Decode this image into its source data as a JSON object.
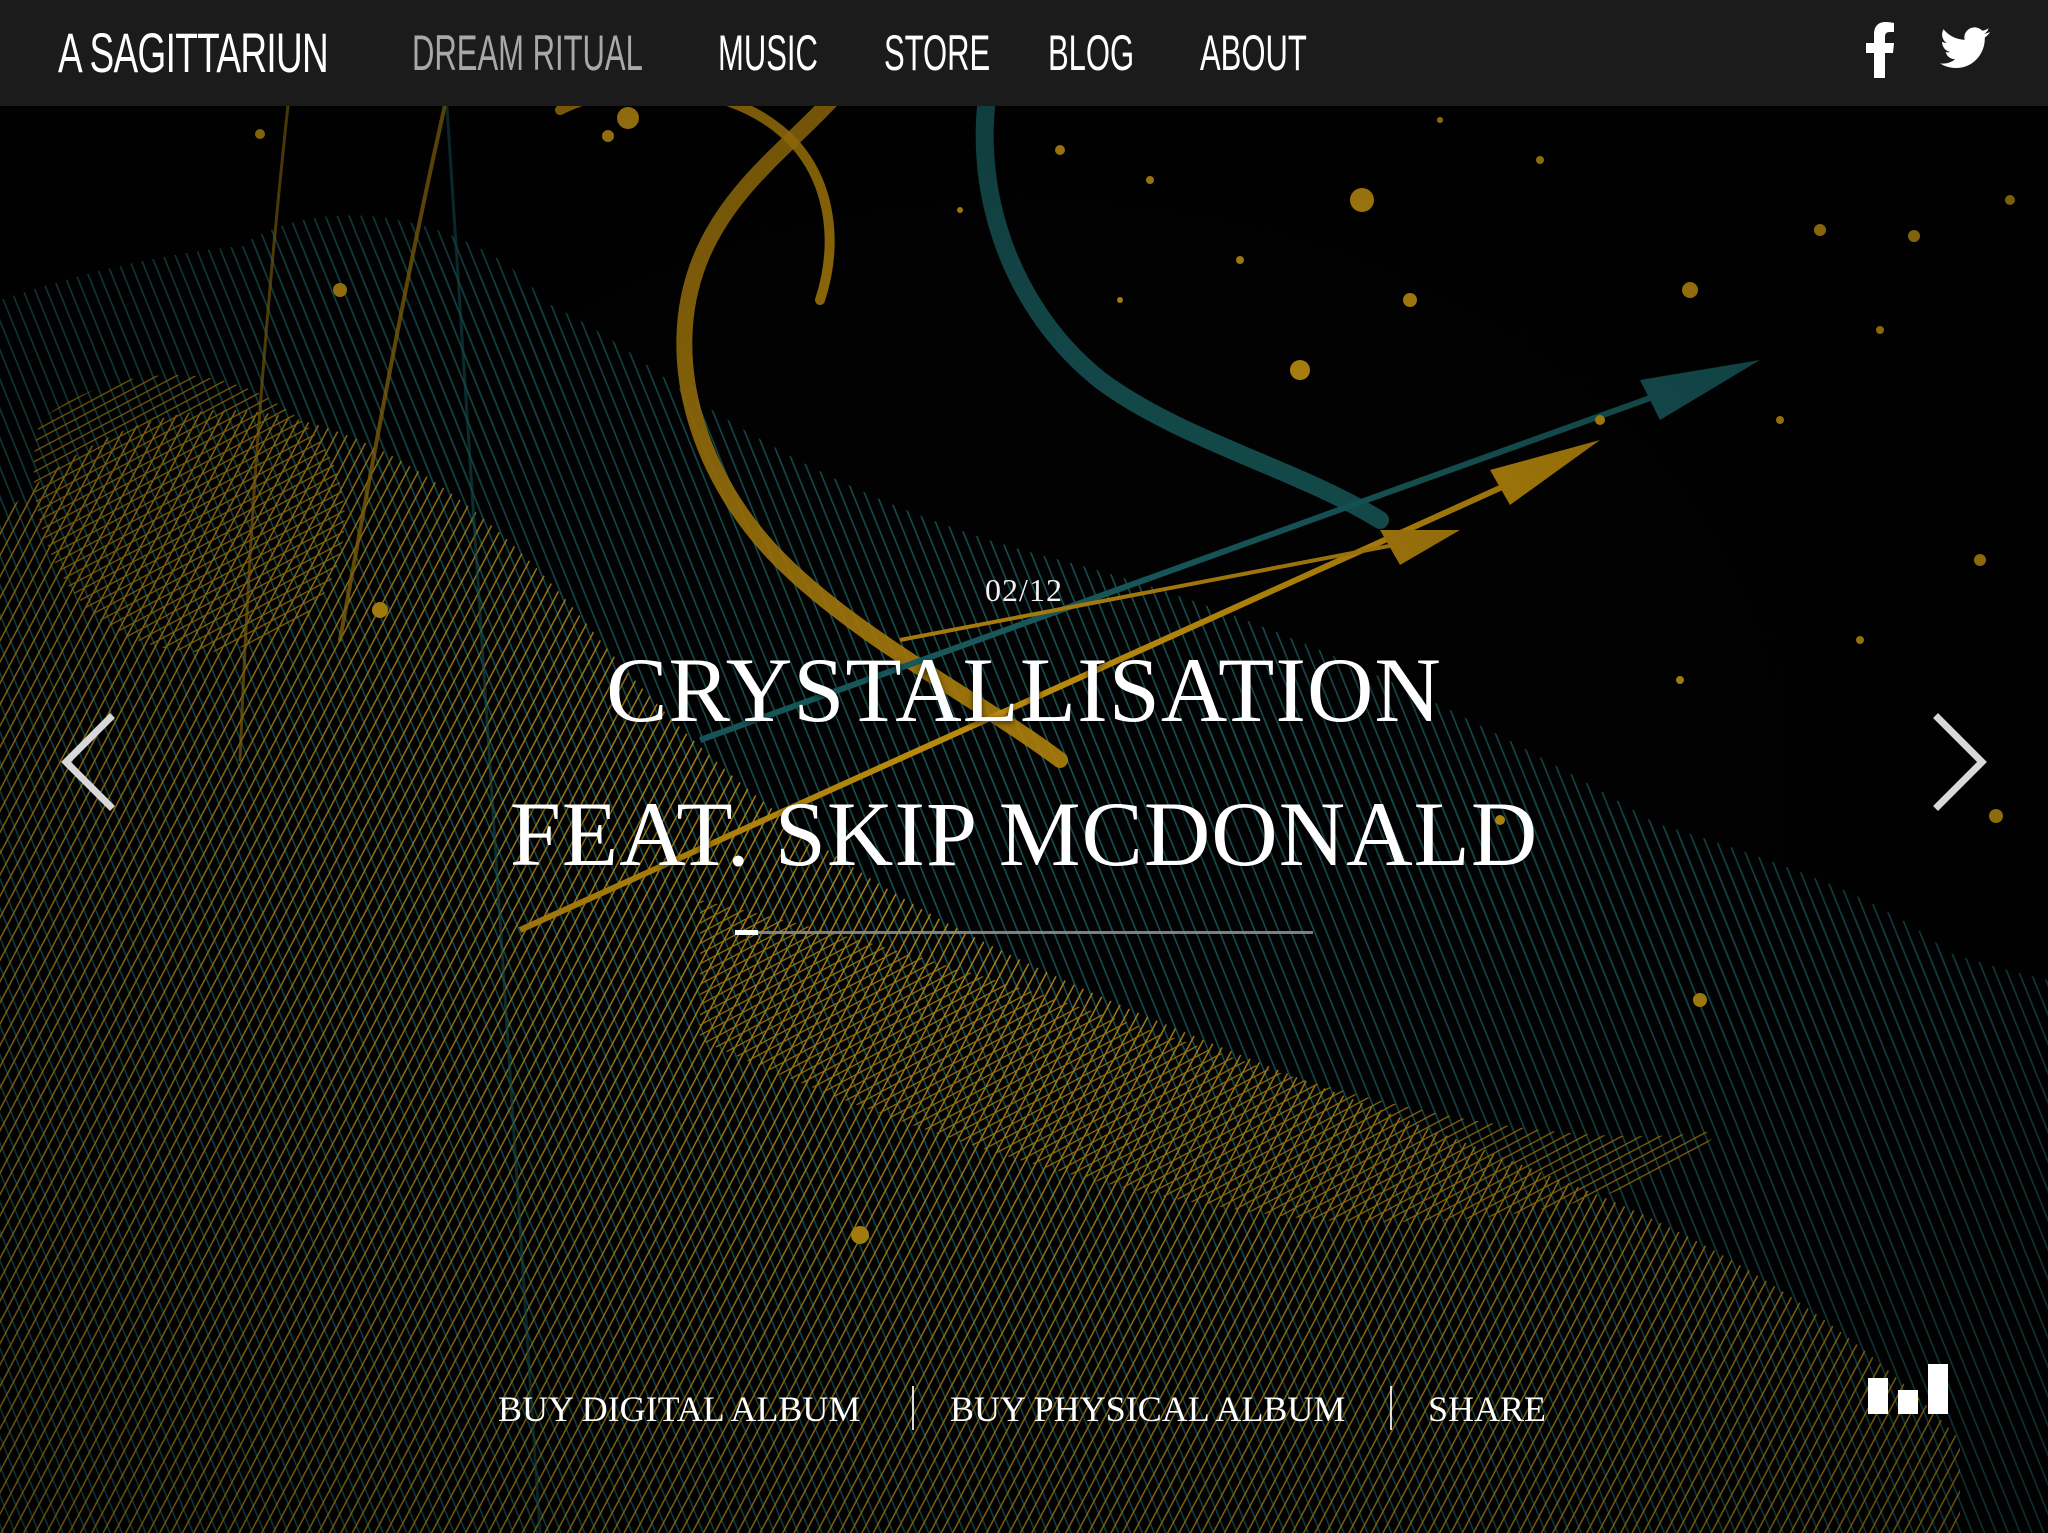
{
  "header": {
    "brand": "A Sagittariun",
    "nav": [
      {
        "label": "Dream Ritual",
        "active": true
      },
      {
        "label": "Music",
        "active": false
      },
      {
        "label": "Store",
        "active": false
      },
      {
        "label": "Blog",
        "active": false
      },
      {
        "label": "About",
        "active": false
      }
    ],
    "social": [
      {
        "icon": "facebook-icon"
      },
      {
        "icon": "twitter-icon"
      }
    ]
  },
  "slide": {
    "counter": "02/12",
    "title_line1": "CRYSTALLISATION",
    "title_line2": "FEAT. SKIP MCDONALD",
    "progress": 0.04
  },
  "navigation": {
    "prev_icon": "chevron-left-icon",
    "next_icon": "chevron-right-icon"
  },
  "actions": [
    {
      "label": "BUY DIGITAL ALBUM"
    },
    {
      "label": "BUY PHYSICAL ALBUM"
    },
    {
      "label": "SHARE"
    }
  ],
  "player": {
    "icon": "audio-bars-icon"
  },
  "colors": {
    "header_bg": "#1b1b1b",
    "gold": "#e8b015",
    "teal": "#1f6f73",
    "nav_active": "#a9a9a9"
  }
}
